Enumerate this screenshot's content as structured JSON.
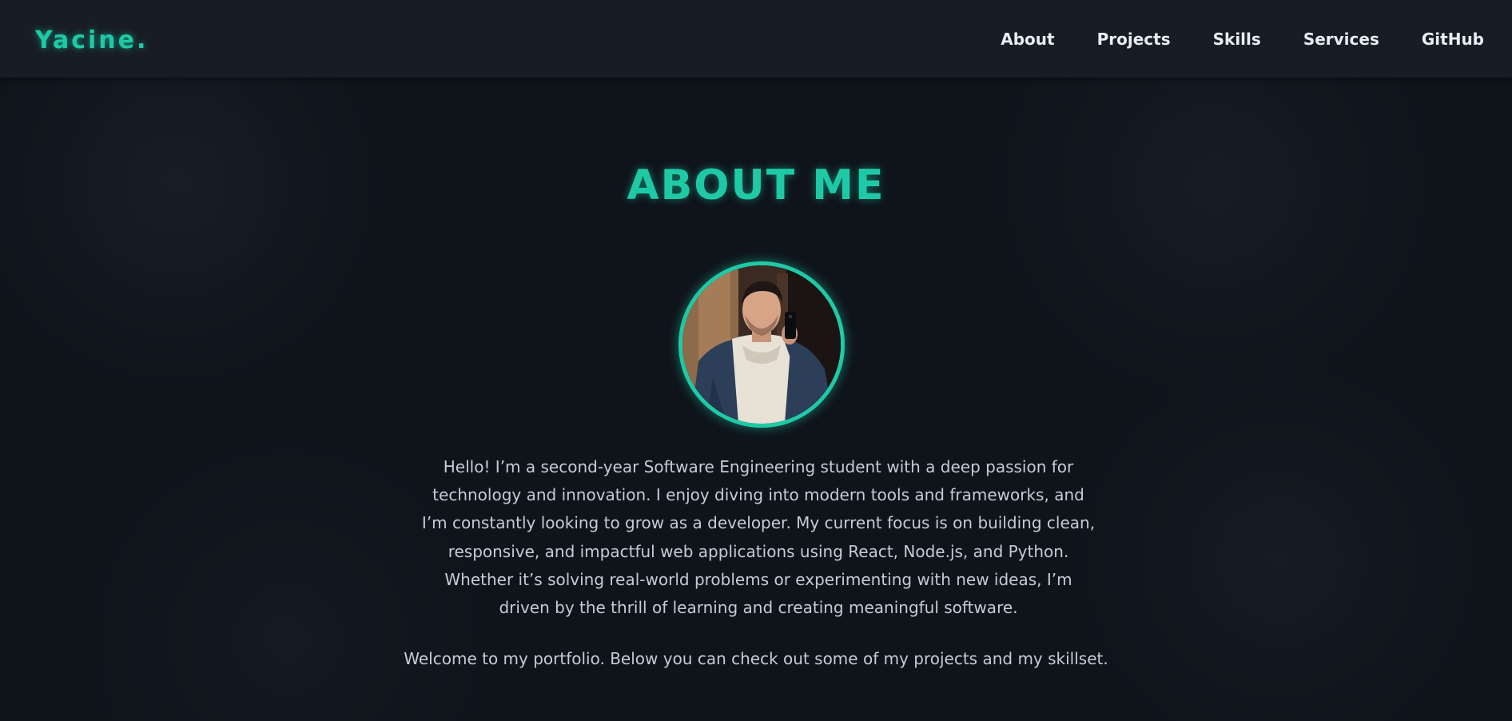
{
  "nav": {
    "logo": "Yacine.",
    "links": [
      {
        "label": "About"
      },
      {
        "label": "Projects"
      },
      {
        "label": "Skills"
      },
      {
        "label": "Services"
      },
      {
        "label": "GitHub"
      }
    ]
  },
  "about": {
    "title": "ABOUT ME",
    "bio": "Hello! I’m a second-year Software Engineering student with a deep passion for technology and innovation. I enjoy diving into modern tools and frameworks, and I’m constantly looking to grow as a developer. My current focus is on building clean, responsive, and impactful web applications using React, Node.js, and Python. Whether it’s solving real-world problems or experimenting with new ideas, I’m driven by the thrill of learning and creating meaningful software.",
    "welcome": "Welcome to my portfolio. Below you can check out some of my projects and my skillset."
  },
  "colors": {
    "accent": "#1fc9a6",
    "background": "#0f141b",
    "navbar": "#181d25",
    "text": "#c6ccd6"
  },
  "icons": {
    "avatar": "profile-photo"
  }
}
